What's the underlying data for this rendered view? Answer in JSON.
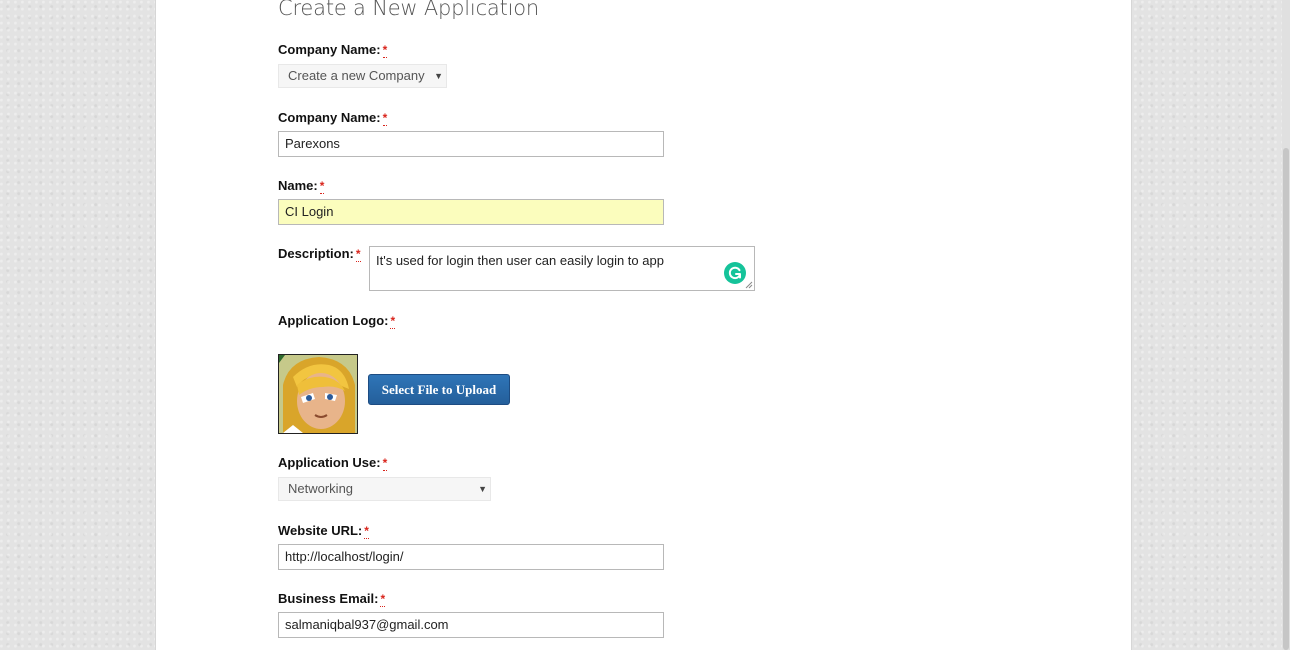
{
  "page": {
    "title": "Create a New Application"
  },
  "form": {
    "required_mark": "*",
    "company_select": {
      "label": "Company Name:",
      "value": "Create a new Company"
    },
    "company_name": {
      "label": "Company Name:",
      "value": "Parexons"
    },
    "name": {
      "label": "Name:",
      "value": "CI Login"
    },
    "description": {
      "label": "Description:",
      "value": "It's used for login then user can easily login to app"
    },
    "logo": {
      "label": "Application Logo:",
      "upload_button": "Select File to Upload"
    },
    "use": {
      "label": "Application Use:",
      "value": "Networking"
    },
    "website": {
      "label": "Website URL:",
      "value": "http://localhost/login/"
    },
    "email": {
      "label": "Business Email:",
      "value": "salmaniqbal937@gmail.com"
    }
  },
  "icons": {
    "select_arrow": "chevron-down-icon",
    "grammarly": "grammarly-icon",
    "resize": "resize-handle-icon"
  },
  "colors": {
    "required": "#d9251c",
    "button": "#2a6aab",
    "autofill": "#fbfdbd",
    "grammarly": "#15c39a"
  }
}
